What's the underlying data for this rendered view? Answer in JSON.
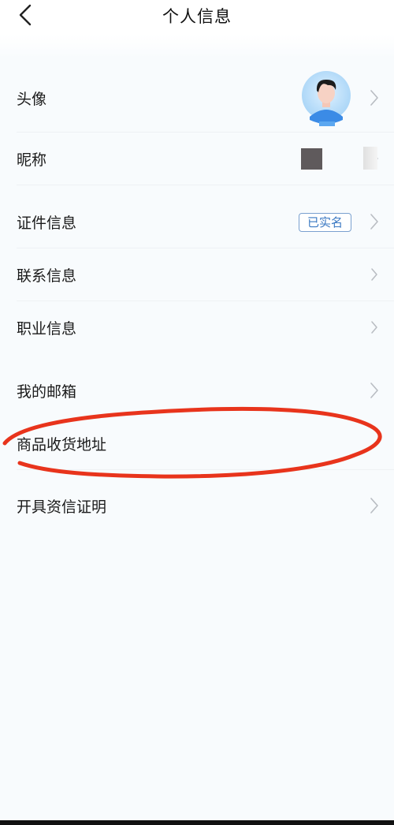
{
  "header": {
    "title": "个人信息",
    "back_icon": "chevron-left-icon"
  },
  "rows": {
    "avatar": {
      "label": "头像"
    },
    "nickname": {
      "label": "昵称"
    },
    "id_info": {
      "label": "证件信息",
      "badge": "已实名"
    },
    "contact": {
      "label": "联系信息"
    },
    "career": {
      "label": "职业信息"
    },
    "email": {
      "label": "我的邮箱"
    },
    "address": {
      "label": "商品收货地址"
    },
    "credit": {
      "label": "开具资信证明"
    }
  },
  "colors": {
    "accent_badge": "#3a78c2",
    "annotation": "#e8341c",
    "background": "#f8fbfd"
  }
}
